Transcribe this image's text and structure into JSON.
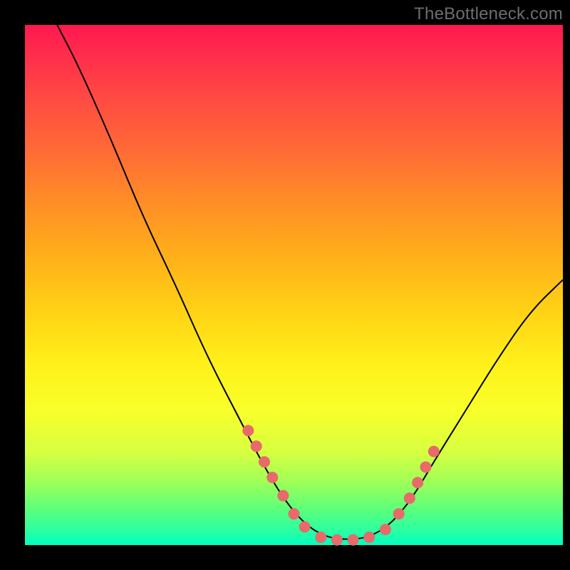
{
  "watermark": "TheBottleneck.com",
  "colors": {
    "dot": "#e86a6a",
    "curve": "#000000",
    "frame": "#000000"
  },
  "chart_data": {
    "type": "line",
    "title": "",
    "xlabel": "",
    "ylabel": "",
    "xlim": [
      0,
      100
    ],
    "ylim": [
      0,
      100
    ],
    "grid": false,
    "legend": false,
    "curve_approx": [
      {
        "x": 6,
        "y": 100
      },
      {
        "x": 10,
        "y": 92
      },
      {
        "x": 16,
        "y": 78
      },
      {
        "x": 22,
        "y": 63
      },
      {
        "x": 28,
        "y": 50
      },
      {
        "x": 34,
        "y": 36
      },
      {
        "x": 40,
        "y": 24
      },
      {
        "x": 44,
        "y": 16
      },
      {
        "x": 48,
        "y": 9
      },
      {
        "x": 52,
        "y": 4
      },
      {
        "x": 56,
        "y": 1.5
      },
      {
        "x": 60,
        "y": 1
      },
      {
        "x": 64,
        "y": 1.5
      },
      {
        "x": 68,
        "y": 4
      },
      {
        "x": 72,
        "y": 9
      },
      {
        "x": 76,
        "y": 16
      },
      {
        "x": 82,
        "y": 26
      },
      {
        "x": 88,
        "y": 36
      },
      {
        "x": 94,
        "y": 45
      },
      {
        "x": 100,
        "y": 51
      }
    ],
    "marker_points": [
      {
        "x": 41.5,
        "y": 22
      },
      {
        "x": 43,
        "y": 19
      },
      {
        "x": 44.5,
        "y": 16
      },
      {
        "x": 46,
        "y": 13
      },
      {
        "x": 48,
        "y": 9.5
      },
      {
        "x": 50,
        "y": 6
      },
      {
        "x": 52,
        "y": 3.5
      },
      {
        "x": 55,
        "y": 1.5
      },
      {
        "x": 58,
        "y": 1
      },
      {
        "x": 61,
        "y": 1
      },
      {
        "x": 64,
        "y": 1.5
      },
      {
        "x": 67,
        "y": 3
      },
      {
        "x": 69.5,
        "y": 6
      },
      {
        "x": 71.5,
        "y": 9
      },
      {
        "x": 73,
        "y": 12
      },
      {
        "x": 74.5,
        "y": 15
      },
      {
        "x": 76,
        "y": 18
      }
    ],
    "marker_radius": 8
  }
}
